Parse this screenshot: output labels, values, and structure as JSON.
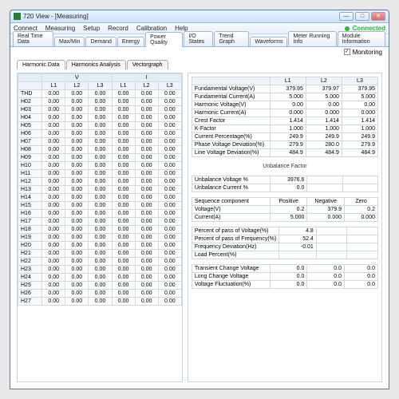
{
  "window": {
    "title": "720 View - [Measuring]"
  },
  "menu": [
    "Connect",
    "Measuring",
    "Setup",
    "Record",
    "Calibration",
    "Help"
  ],
  "status": {
    "connected": "Connected",
    "monitoring": "Monitoring"
  },
  "mainTabs": [
    "Real Time Data",
    "Max/Min",
    "Demand",
    "Energy",
    "Power Quality",
    "I/O States",
    "Trend Graph",
    "Waveforms",
    "Meter Running Info",
    "Module Information"
  ],
  "mainTabActive": 4,
  "subTabs": [
    "Harmonic Data",
    "Harmonics Analysis",
    "Vectorgraph"
  ],
  "subTabActive": 0,
  "harm": {
    "groups": [
      "V",
      "I"
    ],
    "cols": [
      "L1",
      "L2",
      "L3",
      "L1",
      "L2",
      "L3"
    ],
    "rows": [
      "THD",
      "H02",
      "H03",
      "H04",
      "H05",
      "H06",
      "H07",
      "H08",
      "H09",
      "H10",
      "H11",
      "H12",
      "H13",
      "H14",
      "H15",
      "H16",
      "H17",
      "H18",
      "H19",
      "H20",
      "H21",
      "H22",
      "H23",
      "H24",
      "H25",
      "H26",
      "H27"
    ],
    "val": "0.00"
  },
  "fund": {
    "cols": [
      "L1",
      "L2",
      "L3"
    ],
    "rows": [
      {
        "label": "Fundamental Voltage(V)",
        "v": [
          "379.95",
          "379.97",
          "379.95"
        ]
      },
      {
        "label": "Fundamental Current(A)",
        "v": [
          "5.000",
          "5.000",
          "5.000"
        ]
      },
      {
        "label": "Harmonic Voltage(V)",
        "v": [
          "0.00",
          "0.00",
          "0.00"
        ]
      },
      {
        "label": "Harmonic Current(A)",
        "v": [
          "0.000",
          "0.000",
          "0.000"
        ]
      },
      {
        "label": "Crest Factor",
        "v": [
          "1.414",
          "1.414",
          "1.414"
        ]
      },
      {
        "label": "K-Factor",
        "v": [
          "1.000",
          "1.000",
          "1.000"
        ]
      },
      {
        "label": "Current Percentage(%)",
        "v": [
          "249.9",
          "249.9",
          "249.9"
        ]
      },
      {
        "label": "Phase Voltage Deviation(%)",
        "v": [
          "279.9",
          "280.0",
          "279.9"
        ]
      },
      {
        "label": "Line Voltage Deviation(%)",
        "v": [
          "484.9",
          "484.9",
          "484.9"
        ]
      }
    ]
  },
  "unbalance": {
    "title": "Unbalance Factor",
    "rows": [
      {
        "label": "Unbalance Voltage %",
        "v": "3976.6"
      },
      {
        "label": "Unbalance Current %",
        "v": "0.0"
      }
    ],
    "seq": {
      "header": "Sequence component",
      "cols": [
        "Positive",
        "Negative",
        "Zero"
      ],
      "rows": [
        {
          "label": "Voltage(V)",
          "v": [
            "0.2",
            "379.9",
            "0.2"
          ]
        },
        {
          "label": "Current(A)",
          "v": [
            "5.000",
            "0.000",
            "0.000"
          ]
        }
      ]
    }
  },
  "percent": [
    {
      "label": "Percent of pass of Voltage(%)",
      "v": "4.8"
    },
    {
      "label": "Percent of pass of Frequency(%)",
      "v": "52.4"
    },
    {
      "label": "Frequency Deviation(Hz)",
      "v": "-0.01"
    },
    {
      "label": "Load Percent(%)",
      "v": ""
    }
  ],
  "trans": {
    "cols": [
      "",
      "",
      ""
    ],
    "rows": [
      {
        "label": "Transient Change Voltage",
        "v": [
          "0.0",
          "0.0",
          "0.0"
        ]
      },
      {
        "label": "Long Change Voltage",
        "v": [
          "0.0",
          "0.0",
          "0.0"
        ]
      },
      {
        "label": "Voltage Fluctuation(%)",
        "v": [
          "0.0",
          "0.0",
          "0.0"
        ]
      }
    ]
  }
}
